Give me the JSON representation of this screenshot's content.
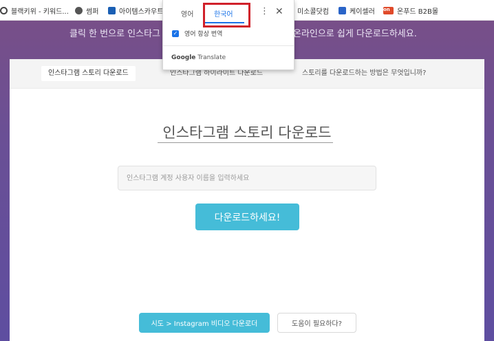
{
  "bookmarks": [
    {
      "label": "블랙키위 - 키워드...",
      "icon": "radio-dot-icon"
    },
    {
      "label": "썸퍼",
      "icon": "globe-icon"
    },
    {
      "label": "아이템스카우트",
      "icon": "wave-icon"
    },
    {
      "label": "미소콜닷컴",
      "icon": "doc-icon"
    },
    {
      "label": "케이셀러",
      "icon": "doc-icon"
    },
    {
      "label": "온푸드 B2B몰",
      "icon": "on-icon",
      "icon_text": "on"
    }
  ],
  "hero": {
    "text_left": "클릭 한 번으로 인스타그",
    "text_right": "온라인으로 쉽게 다운로드하세요."
  },
  "tabs": [
    {
      "label": "인스타그램 스토리 다운로드",
      "active": true
    },
    {
      "label": "인스타그램 하이라이트 다운로드",
      "active": false
    },
    {
      "label": "스토리를 다운로드하는 방법은 무엇입니까?",
      "active": false
    }
  ],
  "main": {
    "title": "인스타그램 스토리 다운로드",
    "search_placeholder": "인스타그램 계정 사용자 이름을 입력하세요",
    "download_label": "다운로드하세요!",
    "instagram_video_label": "시도 > Instagram 비디오 다운로더",
    "help_label": "도움이 필요하다?"
  },
  "translate_popup": {
    "source_lang": "영어",
    "target_lang": "한국어",
    "always_translate": "영어 항상 번역",
    "brand_google": "Google",
    "brand_translate": "Translate"
  },
  "colors": {
    "accent": "#45bcd8",
    "google_blue": "#1a73e8",
    "highlight_red": "#d0202a"
  }
}
